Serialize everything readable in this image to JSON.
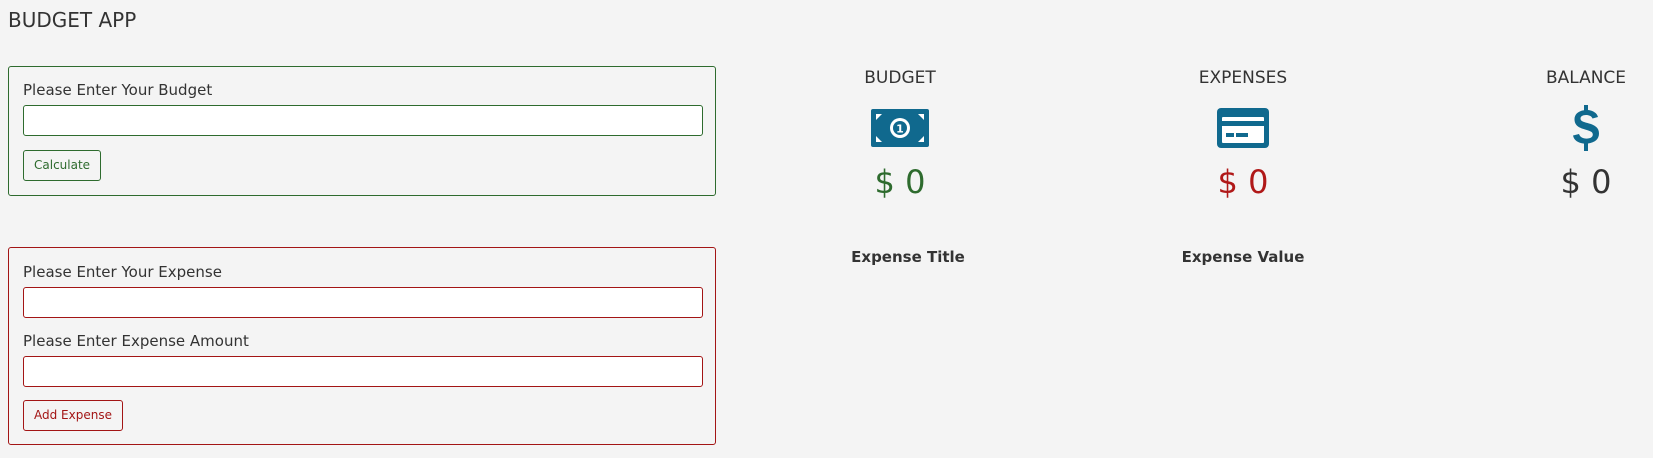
{
  "app": {
    "title": "BUDGET APP"
  },
  "budget_form": {
    "label": "Please Enter Your Budget",
    "input_value": "",
    "button_label": "Calculate"
  },
  "expense_form": {
    "expense_label": "Please Enter Your Expense",
    "expense_value": "",
    "amount_label": "Please Enter Expense Amount",
    "amount_value": "",
    "button_label": "Add Expense"
  },
  "summary": {
    "budget": {
      "heading": "BUDGET",
      "amount": "$ 0",
      "icon": "money-bill-icon",
      "color": "#2e6b2e"
    },
    "expenses": {
      "heading": "EXPENSES",
      "amount": "$ 0",
      "icon": "credit-card-icon",
      "color": "#b01818"
    },
    "balance": {
      "heading": "BALANCE",
      "amount": "$ 0",
      "icon": "dollar-sign-icon",
      "color": "#333333"
    }
  },
  "expense_list": {
    "title_header": "Expense Title",
    "value_header": "Expense Value"
  },
  "colors": {
    "background": "#f4f4f4",
    "icon": "#10698e",
    "budget_accent": "#2e6b2e",
    "expense_accent": "#a31515"
  }
}
